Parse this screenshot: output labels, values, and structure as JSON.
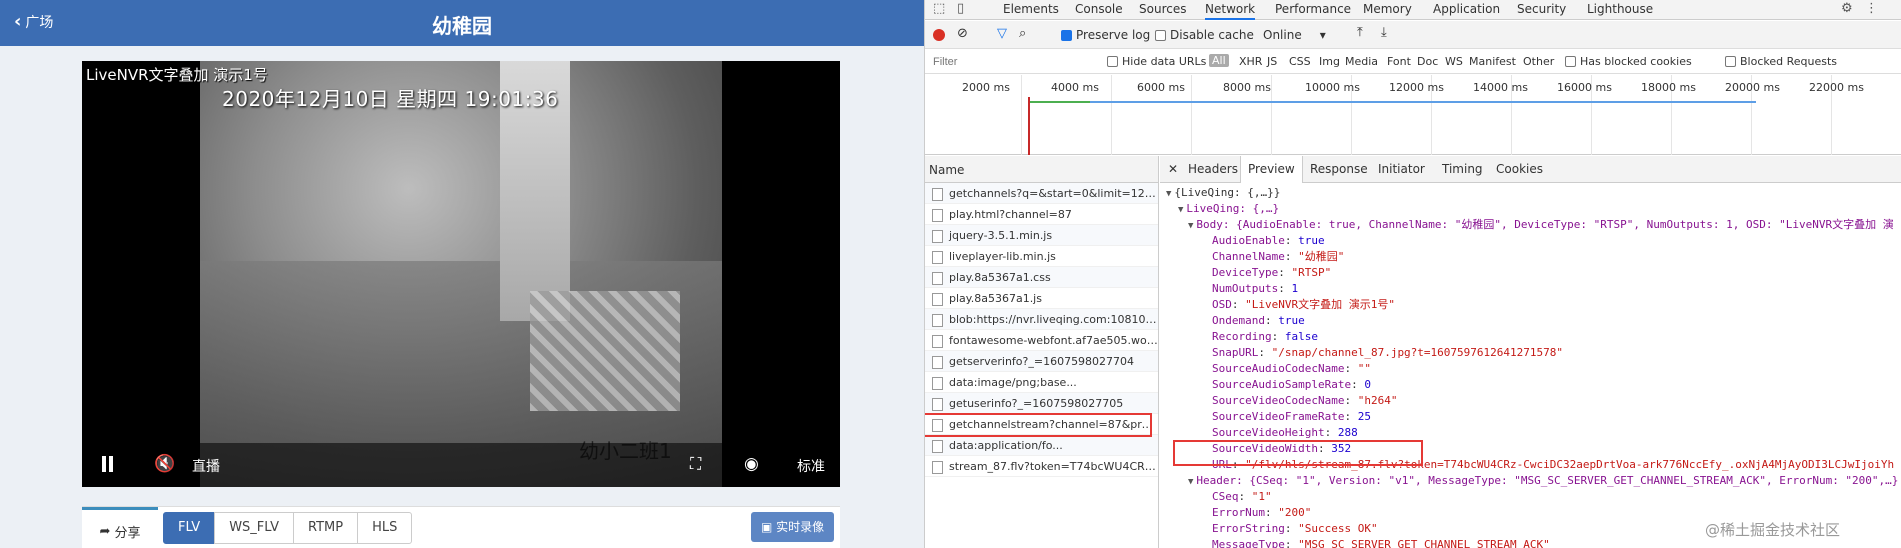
{
  "app": {
    "back_label": "广场",
    "title": "幼稚园",
    "player": {
      "osd_label": "LiveNVR文字叠加 演示1号",
      "osd_time": "2020年12月10日  星期四  19:01:36",
      "osd_class": "幼小二班1",
      "live_label": "直播",
      "quality_label": "标准"
    },
    "share_label": "分享",
    "protocols": [
      "FLV",
      "WS_FLV",
      "RTMP",
      "HLS"
    ],
    "active_protocol": "FLV",
    "record_label": "实时录像"
  },
  "devtools": {
    "top_tabs": [
      "Elements",
      "Console",
      "Sources",
      "Network",
      "Performance",
      "Memory",
      "Application",
      "Security",
      "Lighthouse"
    ],
    "active_top_tab": "Network",
    "toolbar": {
      "preserve_log": "Preserve log",
      "disable_cache": "Disable cache",
      "throttle": "Online"
    },
    "filter": {
      "placeholder": "Filter",
      "hide_data_urls": "Hide data URLs",
      "types": [
        "All",
        "XHR",
        "JS",
        "CSS",
        "Img",
        "Media",
        "Font",
        "Doc",
        "WS",
        "Manifest",
        "Other"
      ],
      "has_blocked_cookies": "Has blocked cookies",
      "blocked_requests": "Blocked Requests"
    },
    "timeline_ticks": [
      "2000 ms",
      "4000 ms",
      "6000 ms",
      "8000 ms",
      "10000 ms",
      "12000 ms",
      "14000 ms",
      "16000 ms",
      "18000 ms",
      "20000 ms",
      "22000 ms"
    ],
    "list_header": "Name",
    "requests": [
      "getchannels?q=&start=0&limit=12&...",
      "play.html?channel=87",
      "jquery-3.5.1.min.js",
      "liveplayer-lib.min.js",
      "play.8a5367a1.css",
      "play.8a5367a1.js",
      "blob:https://nvr.liveqing.com:10810/0...",
      "fontawesome-webfont.af7ae505.woff2",
      "getserverinfo?_=1607598027704",
      "data:image/png;base...",
      "getuserinfo?_=1607598027705",
      "getchannelstream?channel=87&prot...",
      "data:application/fo...",
      "stream_87.flv?token=T74bcWU4CRz-..."
    ],
    "detail_tabs": [
      "Headers",
      "Preview",
      "Response",
      "Initiator",
      "Timing",
      "Cookies"
    ],
    "active_detail_tab": "Preview",
    "preview": {
      "root": "{LiveQing: {,…}}",
      "liveqing": "LiveQing: {,…}",
      "body_summary": "Body: {AudioEnable: true, ChannelName: \"幼稚园\", DeviceType: \"RTSP\", NumOutputs: 1, OSD: \"LiveNVR文字叠加 演",
      "fields": [
        {
          "key": "AudioEnable",
          "value": "true",
          "type": "n"
        },
        {
          "key": "ChannelName",
          "value": "\"幼稚园\"",
          "type": "s"
        },
        {
          "key": "DeviceType",
          "value": "\"RTSP\"",
          "type": "s"
        },
        {
          "key": "NumOutputs",
          "value": "1",
          "type": "n"
        },
        {
          "key": "OSD",
          "value": "\"LiveNVR文字叠加 演示1号\"",
          "type": "s"
        },
        {
          "key": "Ondemand",
          "value": "true",
          "type": "n"
        },
        {
          "key": "Recording",
          "value": "false",
          "type": "n"
        },
        {
          "key": "SnapURL",
          "value": "\"/snap/channel_87.jpg?t=1607597612641271578\"",
          "type": "s"
        },
        {
          "key": "SourceAudioCodecName",
          "value": "\"\"",
          "type": "s"
        },
        {
          "key": "SourceAudioSampleRate",
          "value": "0",
          "type": "n"
        },
        {
          "key": "SourceVideoCodecName",
          "value": "\"h264\"",
          "type": "s"
        },
        {
          "key": "SourceVideoFrameRate",
          "value": "25",
          "type": "n"
        },
        {
          "key": "SourceVideoHeight",
          "value": "288",
          "type": "n"
        },
        {
          "key": "SourceVideoWidth",
          "value": "352",
          "type": "n"
        },
        {
          "key": "URL",
          "value": "\"/flv/hls/stream_87.flv?token=T74bcWU4CRz-CwciDC32aepDrtVoa-ark776NccEfy_.oxNjA4MjAyODI3LCJwIjoiYh",
          "type": "s"
        }
      ],
      "header_summary": "Header: {CSeq: \"1\", Version: \"v1\", MessageType: \"MSG_SC_SERVER_GET_CHANNEL_STREAM_ACK\", ErrorNum: \"200\",…}",
      "header_fields": [
        {
          "key": "CSeq",
          "value": "\"1\"",
          "type": "s"
        },
        {
          "key": "ErrorNum",
          "value": "\"200\"",
          "type": "s"
        },
        {
          "key": "ErrorString",
          "value": "\"Success OK\"",
          "type": "s"
        },
        {
          "key": "MessageType",
          "value": "\"MSG_SC_SERVER_GET_CHANNEL_STREAM_ACK\"",
          "type": "s"
        }
      ]
    },
    "watermark": "@稀土掘金技术社区"
  }
}
